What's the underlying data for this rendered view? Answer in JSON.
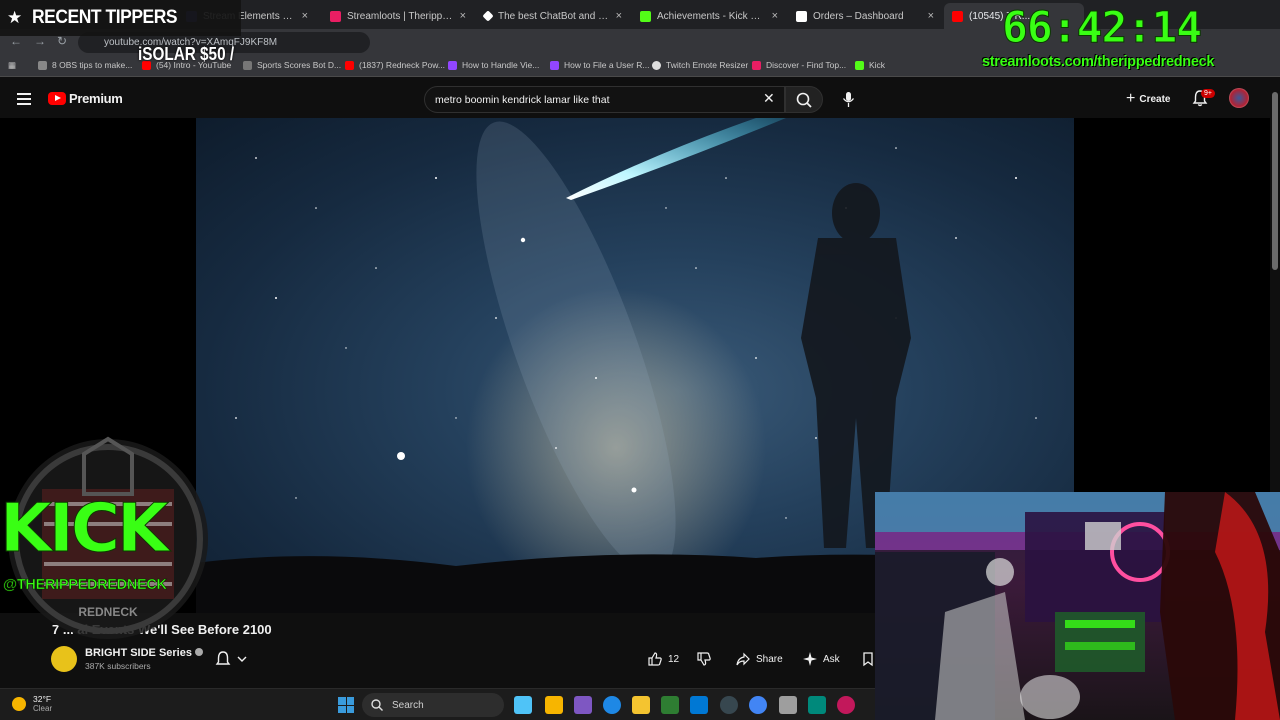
{
  "browser": {
    "tabs": [
      {
        "label": "Stream Elements - rippedredne...",
        "favicon_color": "#3b3b8f",
        "active": false
      },
      {
        "label": "Streamloots | Therippedredne...",
        "favicon_color": "#e91e63",
        "active": false
      },
      {
        "label": "The best ChatBot and Widgets...",
        "favicon_color": "#ffffff",
        "active": false
      },
      {
        "label": "Achievements - Kick Dashboard",
        "favicon_color": "#53fc18",
        "active": false
      },
      {
        "label": "Orders – Dashboard",
        "favicon_color": "#ffffff",
        "active": false
      },
      {
        "label": "(10545) 7 R...",
        "favicon_color": "#ff0000",
        "active": true
      }
    ],
    "tab_close_glyph": "×",
    "url": "youtube.com/watch?v=XAmqFJ9KF8M",
    "bookmarks": [
      {
        "label": "8 OBS tips to make...",
        "icon_color": "#888888"
      },
      {
        "label": "(54) Intro - YouTube",
        "icon_color": "#ff0000"
      },
      {
        "label": "Sports Scores Bot D...",
        "icon_color": "#777777"
      },
      {
        "label": "(1837) Redneck Pow...",
        "icon_color": "#ff0000"
      },
      {
        "label": "How to Handle Vie...",
        "icon_color": "#9146ff"
      },
      {
        "label": "How to File a User R...",
        "icon_color": "#9146ff"
      },
      {
        "label": "Twitch Emote Resizer",
        "icon_color": "#dddddd"
      },
      {
        "label": "Discover - Find Top...",
        "icon_color": "#e91e63"
      },
      {
        "label": "Kick",
        "icon_color": "#53fc18"
      }
    ]
  },
  "youtube": {
    "brand": "Premium",
    "search_value": "metro boomin kendrick lamar like that",
    "create_label": "Create",
    "notification_badge": "9+"
  },
  "video": {
    "title": "7 ... al Events We'll See Before 2100",
    "channel": "BRIGHT SIDE Series",
    "subscribers": "387K subscribers",
    "likes": "12",
    "share_label": "Share",
    "ask_label": "Ask"
  },
  "taskbar": {
    "temperature": "32°F",
    "condition": "Clear",
    "search_label": "Search",
    "apps": [
      "#4fc3f7",
      "#f7b500",
      "#7e57c2",
      "#1e88e5",
      "#2e7d32",
      "#e53935",
      "#0078d4",
      "#ef5350",
      "#4285f4",
      "#9e9e9e",
      "#00897b",
      "#c2185b"
    ]
  },
  "overlay": {
    "recent_tippers_title": "RECENT TIPPERS",
    "tip_entry": "iSOLAR $50 /",
    "timer": "66:42:14",
    "streamloots_url": "streamloots.com/therippedredneck",
    "kick_text": "KICK",
    "kick_handle": "@THERIPPEDREDNECK",
    "emblem_text": "REDNECK"
  },
  "colors": {
    "accent_green": "#39ff14",
    "youtube_red": "#ff0000",
    "page_background": "#0f0f0f"
  }
}
